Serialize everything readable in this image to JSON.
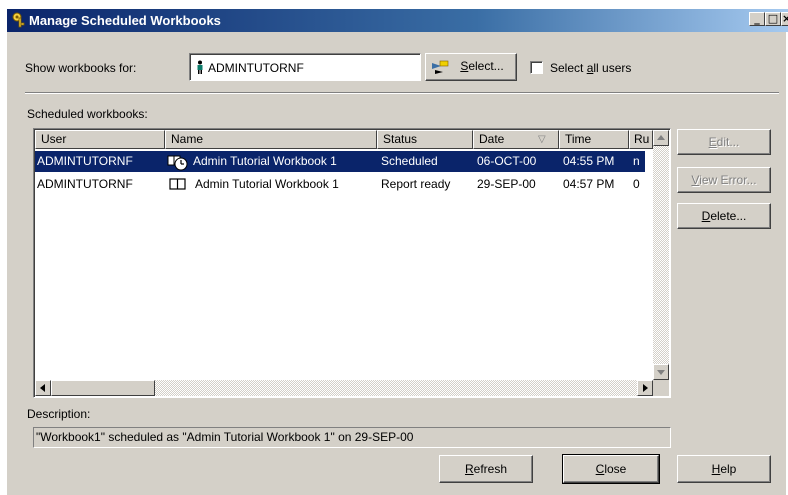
{
  "window": {
    "title": "Manage Scheduled Workbooks",
    "controls": {
      "minimize": "_",
      "maximize": "□",
      "close": "×"
    }
  },
  "filter": {
    "show_label": "Show workbooks for:",
    "user_value": "ADMINTUTORNF",
    "select_button": {
      "accel": "S",
      "rest": "elect..."
    },
    "select_all": {
      "pre": "Select ",
      "accel": "a",
      "rest": "ll users",
      "checked": false
    }
  },
  "list": {
    "caption": "Scheduled workbooks:",
    "columns": [
      "User",
      "Name",
      "Status",
      "Date",
      "Time",
      "Ru"
    ],
    "sort_indicator": "▽",
    "rows": [
      {
        "user": "ADMINTUTORNF",
        "name": "Admin Tutorial Workbook 1",
        "status": "Scheduled",
        "date": "06-OCT-00",
        "time": "04:55 PM",
        "ru": "n",
        "icon": "scheduled-workbook-icon",
        "selected": true
      },
      {
        "user": "ADMINTUTORNF",
        "name": "Admin Tutorial Workbook 1",
        "status": "Report ready",
        "date": "29-SEP-00",
        "time": "04:57 PM",
        "ru": "0",
        "icon": "open-book-icon",
        "selected": false
      }
    ]
  },
  "side_buttons": {
    "edit": {
      "accel": "E",
      "rest": "dit...",
      "enabled": false
    },
    "view_error": {
      "accel": "V",
      "rest": "iew Error...",
      "enabled": false
    },
    "delete": {
      "accel": "D",
      "rest": "elete...",
      "enabled": true
    }
  },
  "description": {
    "label": "Description:",
    "text": "\"Workbook1\" scheduled as \"Admin Tutorial Workbook 1\" on 29-SEP-00"
  },
  "bottom_buttons": {
    "refresh": {
      "accel": "R",
      "rest": "efresh"
    },
    "close": {
      "accel": "C",
      "rest": "lose"
    },
    "help": {
      "accel": "H",
      "rest": "elp"
    }
  },
  "colors": {
    "face": "#d4d0c8",
    "title_start": "#0a246a",
    "title_end": "#a6caf0",
    "selection": "#0a246a"
  }
}
